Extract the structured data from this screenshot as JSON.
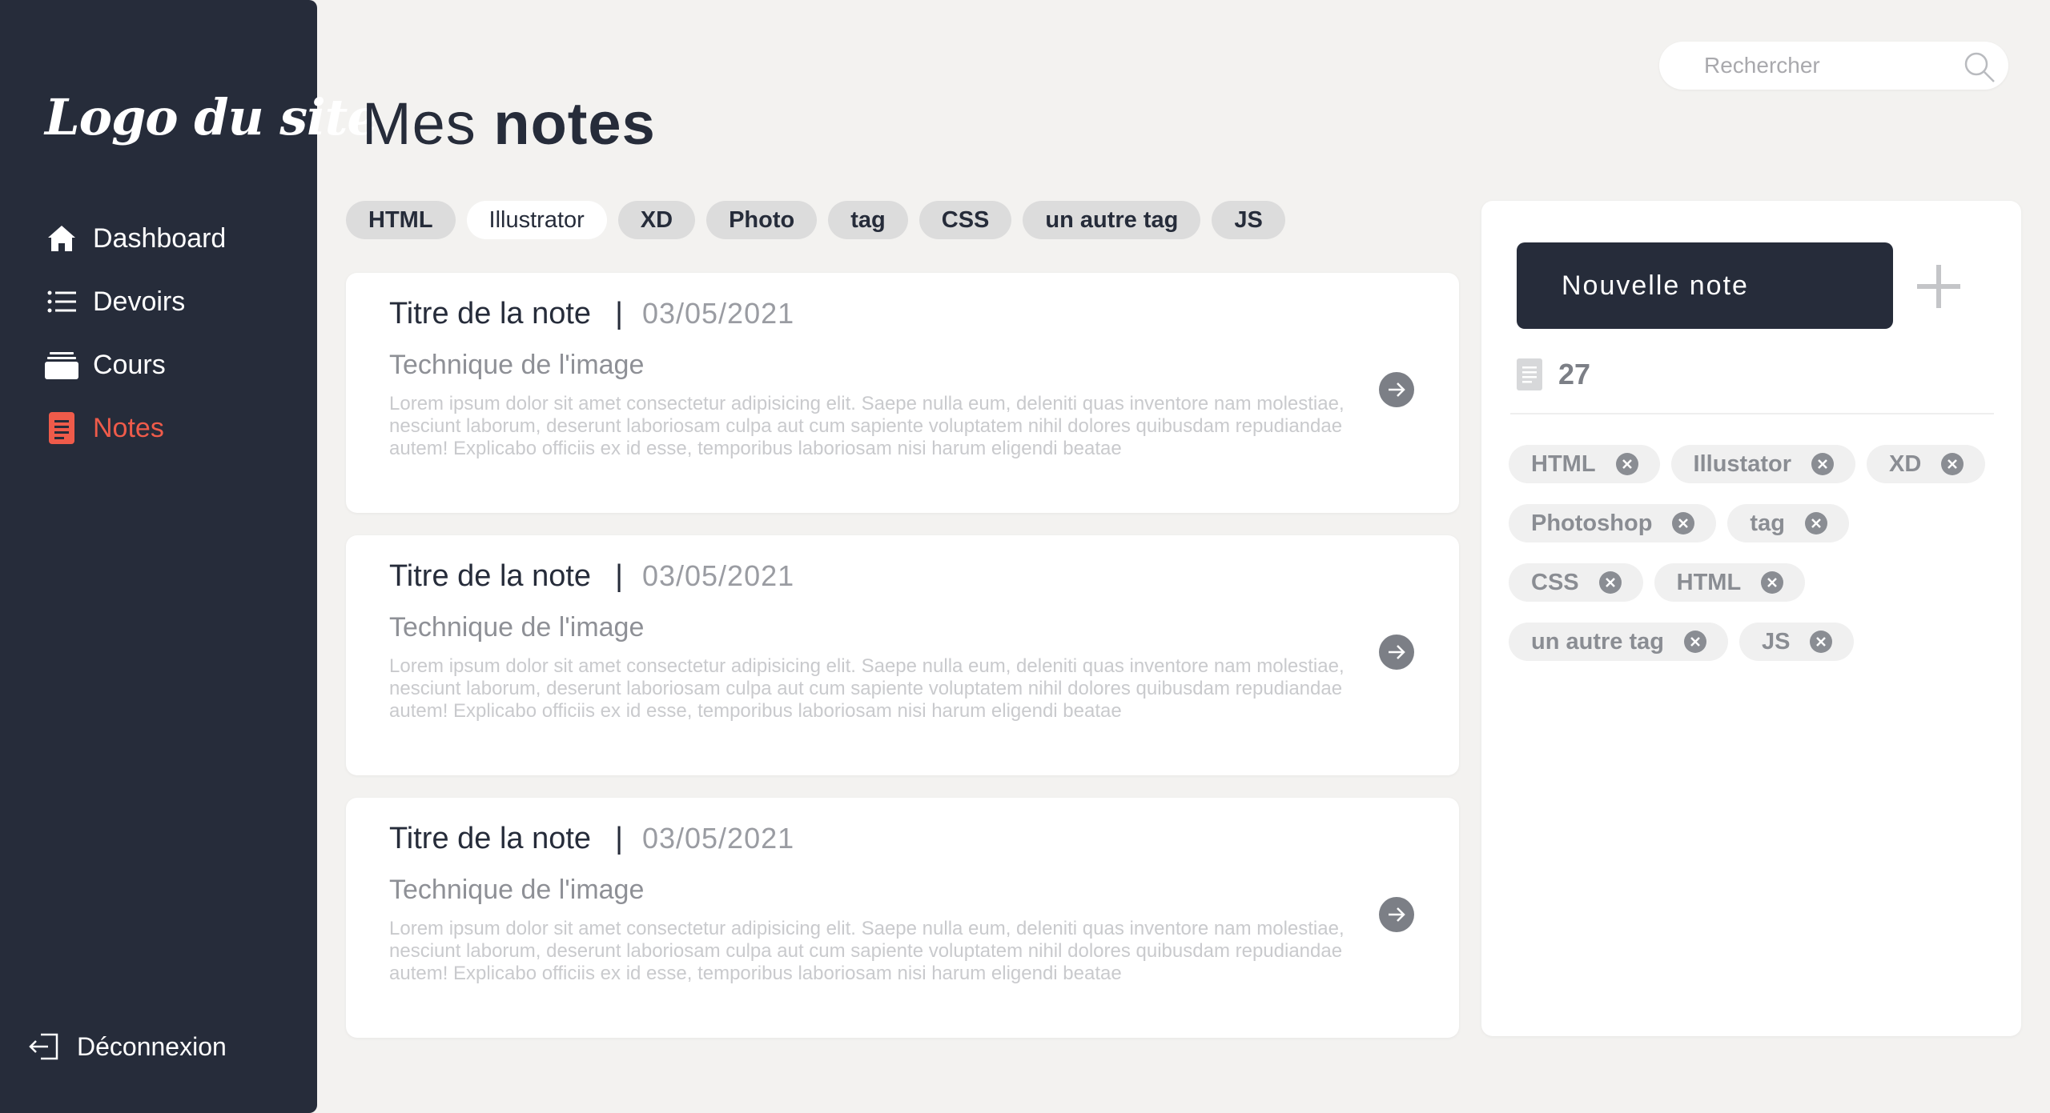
{
  "sidebar": {
    "logo": "Logo du site",
    "items": [
      {
        "label": "Dashboard",
        "icon": "home-icon"
      },
      {
        "label": "Devoirs",
        "icon": "list-icon"
      },
      {
        "label": "Cours",
        "icon": "folder-icon"
      },
      {
        "label": "Notes",
        "icon": "notes-icon",
        "active": true
      }
    ],
    "logout": "Déconnexion",
    "colors": {
      "background": "#262c3a",
      "active": "#ef5b4a"
    }
  },
  "header": {
    "title_light": "Mes",
    "title_bold": "notes",
    "search": {
      "placeholder": "Rechercher",
      "value": ""
    }
  },
  "filter_tags": [
    {
      "label": "HTML",
      "selected": false
    },
    {
      "label": "Illustrator",
      "selected": true
    },
    {
      "label": "XD",
      "selected": false
    },
    {
      "label": "Photo",
      "selected": false
    },
    {
      "label": "tag",
      "selected": false
    },
    {
      "label": "CSS",
      "selected": false
    },
    {
      "label": "un autre tag",
      "selected": false
    },
    {
      "label": "JS",
      "selected": false
    }
  ],
  "notes": [
    {
      "title": "Titre de la note",
      "separator": "|",
      "date": "03/05/2021",
      "subtitle": "Technique de l'image",
      "text": "Lorem ipsum dolor sit amet consectetur adipisicing elit. Saepe nulla eum, deleniti quas inventore nam molestiae, nesciunt laborum, deserunt laboriosam culpa aut cum sapiente voluptatem nihil dolores quibusdam repudiandae autem! Explicabo officiis ex id esse, temporibus laboriosam nisi harum eligendi beatae"
    },
    {
      "title": "Titre de la note",
      "separator": "|",
      "date": "03/05/2021",
      "subtitle": "Technique de l'image",
      "text": "Lorem ipsum dolor sit amet consectetur adipisicing elit. Saepe nulla eum, deleniti quas inventore nam molestiae, nesciunt laborum, deserunt laboriosam culpa aut cum sapiente voluptatem nihil dolores quibusdam repudiandae autem! Explicabo officiis ex id esse, temporibus laboriosam nisi harum eligendi beatae"
    },
    {
      "title": "Titre de la note",
      "separator": "|",
      "date": "03/05/2021",
      "subtitle": "Technique de l'image",
      "text": "Lorem ipsum dolor sit amet consectetur adipisicing elit. Saepe nulla eum, deleniti quas inventore nam molestiae, nesciunt laborum, deserunt laboriosam culpa aut cum sapiente voluptatem nihil dolores quibusdam repudiandae autem! Explicabo officiis ex id esse, temporibus laboriosam nisi harum eligendi beatae"
    }
  ],
  "panel": {
    "new_note_label": "Nouvelle note",
    "count": "27",
    "tag_rows": [
      [
        "HTML",
        "Illustator",
        "XD"
      ],
      [
        "Photoshop",
        "tag"
      ],
      [
        "CSS",
        "HTML"
      ],
      [
        "un autre tag",
        "JS"
      ]
    ]
  }
}
